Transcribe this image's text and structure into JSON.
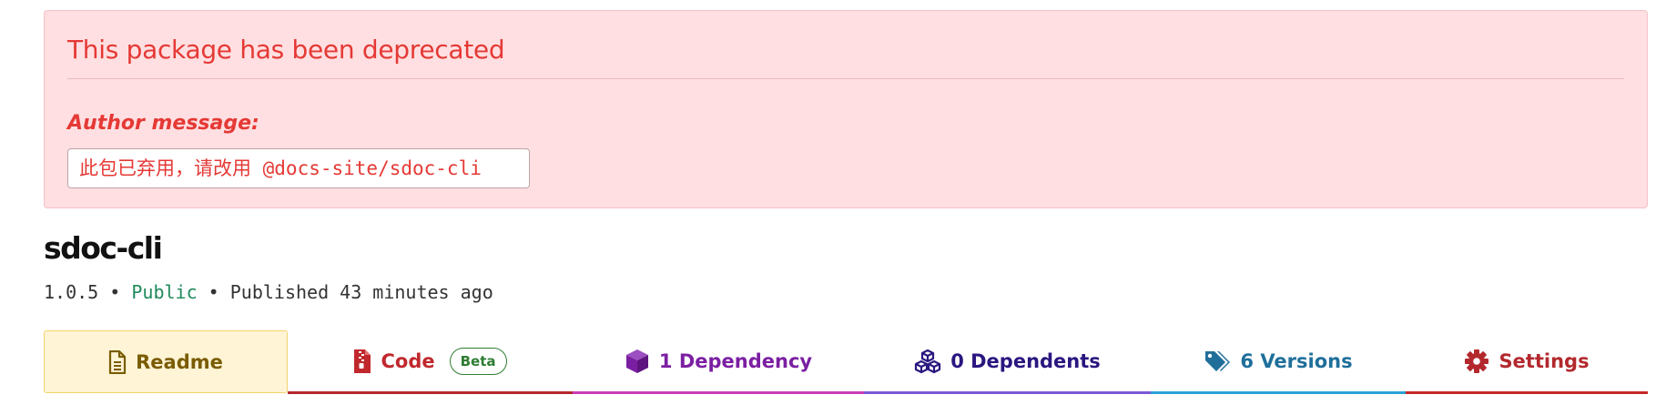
{
  "deprecation": {
    "title": "This package has been deprecated",
    "author_label": "Author message:",
    "message": "此包已弃用，请改用 @docs-site/sdoc-cli"
  },
  "package": {
    "name": "sdoc-cli",
    "version": "1.0.5",
    "separator": "•",
    "visibility": "Public",
    "published": "Published 43 minutes ago"
  },
  "tabs": [
    {
      "label": "Readme",
      "icon": "file-icon",
      "color": "#7a5c00"
    },
    {
      "label": "Code",
      "icon": "zip-file-icon",
      "badge": "Beta",
      "color": "#c0282d"
    },
    {
      "label": "1 Dependency",
      "icon": "cube-icon",
      "color": "#7b1fa2"
    },
    {
      "label": "0 Dependents",
      "icon": "cubes-icon",
      "color": "#2b1680"
    },
    {
      "label": "6 Versions",
      "icon": "tags-icon",
      "color": "#1f6f9a"
    },
    {
      "label": "Settings",
      "icon": "gear-icon",
      "color": "#b3282d"
    }
  ],
  "colors": {
    "danger": "#e53935",
    "banner_bg": "#ffdfe1",
    "public": "#1f8a5b"
  }
}
